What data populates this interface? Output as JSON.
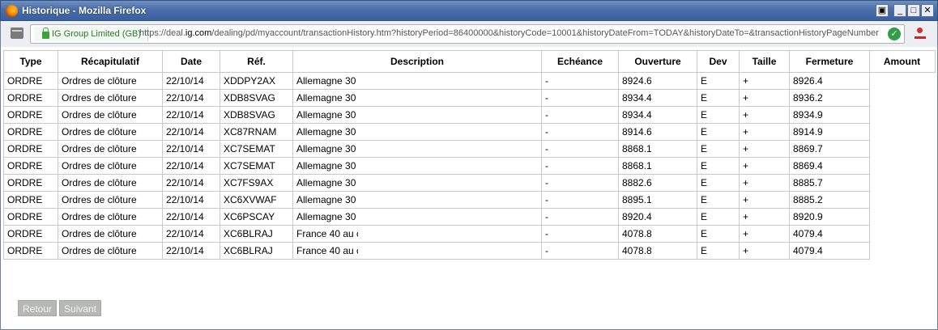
{
  "window": {
    "title": "Historique - Mozilla Firefox"
  },
  "navbar": {
    "identity_label": "IG Group Limited (GB)",
    "url_prefix": "https://deal.",
    "url_domain": "ig.com",
    "url_rest": "/dealing/pd/myaccount/transactionHistory.htm?historyPeriod=86400000&historyCode=10001&historyDateFrom=TODAY&historyDateTo=&transactionHistoryPageNumber"
  },
  "table": {
    "headers": [
      "Type",
      "Récapitulatif",
      "Date",
      "Réf.",
      "Description",
      "Echéance",
      "Ouverture",
      "Dev",
      "Taille",
      "Fermeture",
      "Amount"
    ],
    "rows": [
      [
        "ORDRE",
        "Ordres de clôture",
        "22/10/14",
        "XDDPY2AX",
        "Allemagne 30",
        "-",
        "8924.6",
        "E",
        "+",
        "8926.4"
      ],
      [
        "ORDRE",
        "Ordres de clôture",
        "22/10/14",
        "XDB8SVAG",
        "Allemagne 30",
        "-",
        "8934.4",
        "E",
        "+",
        "8936.2"
      ],
      [
        "ORDRE",
        "Ordres de clôture",
        "22/10/14",
        "XDB8SVAG",
        "Allemagne 30",
        "-",
        "8934.4",
        "E",
        "+",
        "8934.9"
      ],
      [
        "ORDRE",
        "Ordres de clôture",
        "22/10/14",
        "XC87RNAM",
        "Allemagne 30",
        "-",
        "8914.6",
        "E",
        "+",
        "8914.9"
      ],
      [
        "ORDRE",
        "Ordres de clôture",
        "22/10/14",
        "XC7SEMAT",
        "Allemagne 30",
        "-",
        "8868.1",
        "E",
        "+",
        "8869.7"
      ],
      [
        "ORDRE",
        "Ordres de clôture",
        "22/10/14",
        "XC7SEMAT",
        "Allemagne 30",
        "-",
        "8868.1",
        "E",
        "+",
        "8869.4"
      ],
      [
        "ORDRE",
        "Ordres de clôture",
        "22/10/14",
        "XC7FS9AX",
        "Allemagne 30",
        "-",
        "8882.6",
        "E",
        "+",
        "8885.7"
      ],
      [
        "ORDRE",
        "Ordres de clôture",
        "22/10/14",
        "XC6XVWAF",
        "Allemagne 30",
        "-",
        "8895.1",
        "E",
        "+",
        "8885.2"
      ],
      [
        "ORDRE",
        "Ordres de clôture",
        "22/10/14",
        "XC6PSCAY",
        "Allemagne 30",
        "-",
        "8920.4",
        "E",
        "+",
        "8920.9"
      ],
      [
        "ORDRE",
        "Ordres de clôture",
        "22/10/14",
        "XC6BLRAJ",
        "France 40 au c",
        "-",
        "4078.8",
        "E",
        "+",
        "4079.4"
      ],
      [
        "ORDRE",
        "Ordres de clôture",
        "22/10/14",
        "XC6BLRAJ",
        "France 40 au c",
        "-",
        "4078.8",
        "E",
        "+",
        "4079.4"
      ]
    ]
  },
  "pager": {
    "prev_label": "Retour",
    "next_label": "Suivant"
  }
}
